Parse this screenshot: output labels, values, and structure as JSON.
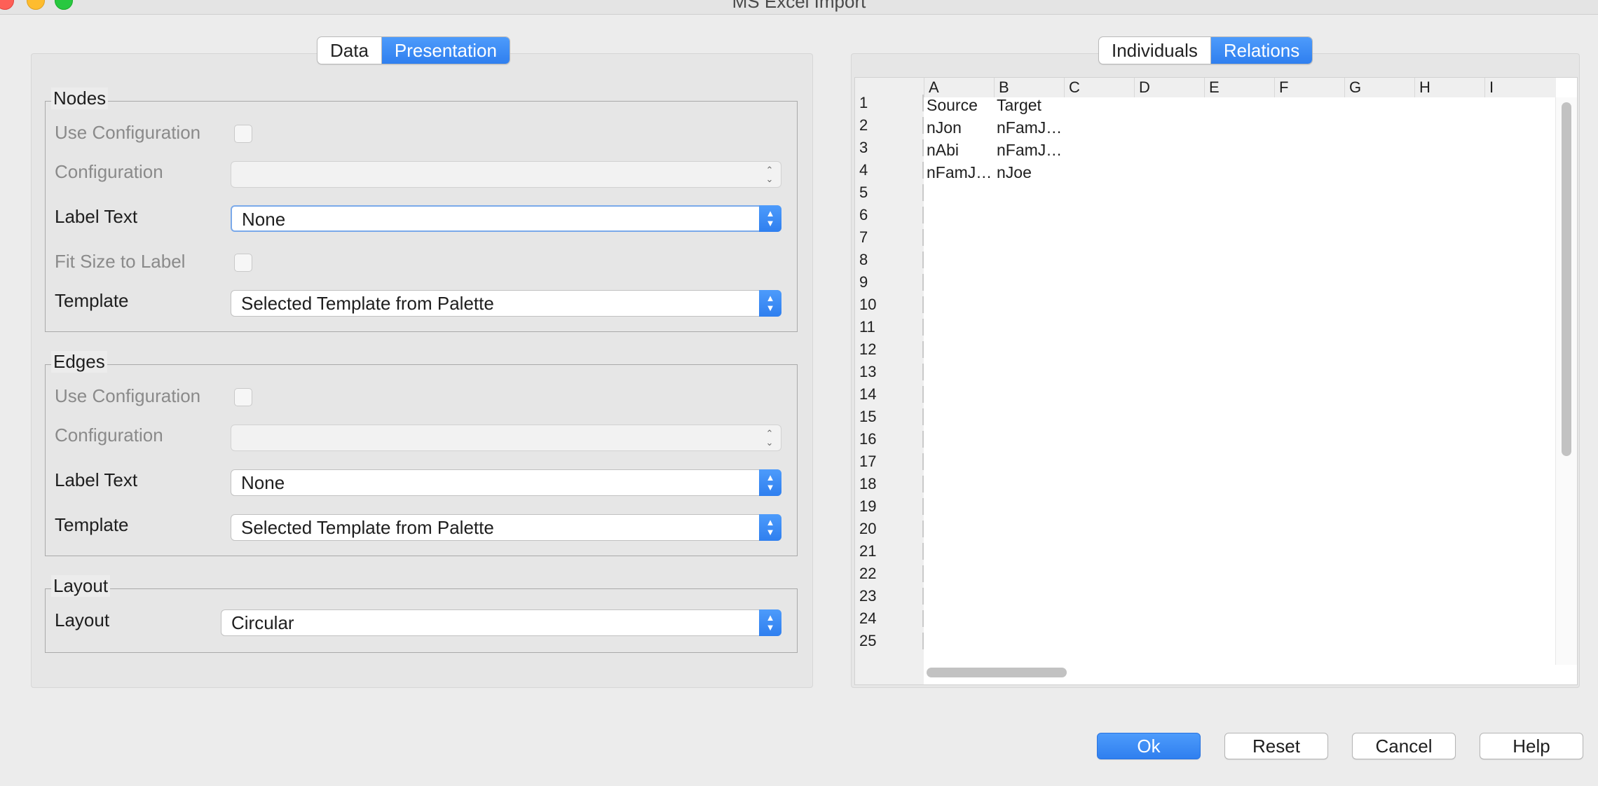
{
  "window": {
    "title": "MS Excel Import"
  },
  "left_tabs": [
    {
      "label": "Data"
    },
    {
      "label": "Presentation"
    }
  ],
  "nodes": {
    "title": "Nodes",
    "use_configuration": "Use Configuration",
    "configuration": "Configuration",
    "label_text": "Label Text",
    "label_text_value": "None",
    "fit_size": "Fit Size to Label",
    "template": "Template",
    "template_value": "Selected Template from Palette"
  },
  "edges": {
    "title": "Edges",
    "use_configuration": "Use Configuration",
    "configuration": "Configuration",
    "label_text": "Label Text",
    "label_text_value": "None",
    "template": "Template",
    "template_value": "Selected Template from Palette"
  },
  "layout": {
    "title": "Layout",
    "label": "Layout",
    "value": "Circular"
  },
  "right_tabs": [
    {
      "label": "Individuals"
    },
    {
      "label": "Relations"
    }
  ],
  "sheet": {
    "columns": [
      "A",
      "B",
      "C",
      "D",
      "E",
      "F",
      "G",
      "H",
      "I"
    ],
    "rows": [
      "1",
      "2",
      "3",
      "4",
      "5",
      "6",
      "7",
      "8",
      "9",
      "10",
      "11",
      "12",
      "13",
      "14",
      "15",
      "16",
      "17",
      "18",
      "19",
      "20",
      "21",
      "22",
      "23",
      "24",
      "25"
    ],
    "cells": [
      [
        "Source",
        "Target"
      ],
      [
        "nJon",
        "nFamJ…"
      ],
      [
        "nAbi",
        "nFamJ…"
      ],
      [
        "nFamJ…",
        "nJoe"
      ]
    ]
  },
  "buttons": {
    "ok": "Ok",
    "reset": "Reset",
    "cancel": "Cancel",
    "help": "Help"
  }
}
